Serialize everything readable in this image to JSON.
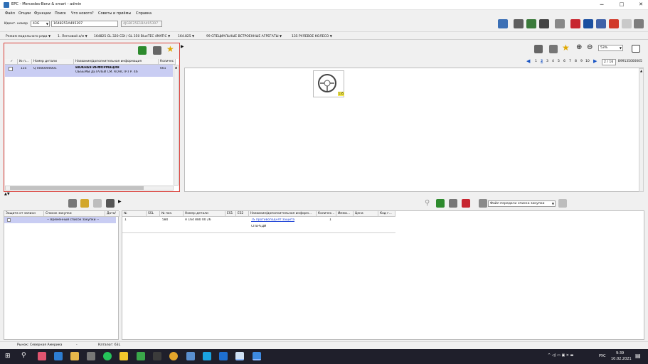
{
  "window": {
    "title": "EPC - Mercedes-Benz & smart - admin",
    "minimize": "─",
    "maximize": "□",
    "close": "✕"
  },
  "menu": [
    "Файл",
    "Опции",
    "Функции",
    "Поиск",
    "Что нового?",
    "Советы и приёмы",
    "Справка"
  ],
  "ident": {
    "label": "Идент. номер",
    "type_value": "43G",
    "number_value": "1648251A495397",
    "secondary_value": "4JGBF25E1BA495397"
  },
  "breadcrumbs": [
    "Режим модельного ряда",
    "1. Легковой а/м",
    "164825 GL 320 CDI / GL 350 BlueTEC 4MATIC",
    "164.825",
    "99 СПЕЦИАЛЬНЫЕ ВСТРОЕННЫЕ АГРЕГАТЫ",
    "135 РУЛЕВОЕ КОЛЕСО"
  ],
  "parts_table": {
    "columns": [
      "✓",
      "№ п...",
      "Номер детали",
      "Название/дополнительная информация",
      "Количес"
    ],
    "rows": [
      {
        "pos": "135",
        "part": "Q 0000000001",
        "title": "ВАЖНАЯ ИНФОРМАЦИЯ",
        "subtitle": "ОБЪЕМЫ ДЕТАЛЕЙ СМ. КОНСТР.ГР. 46",
        "qty": "001"
      }
    ]
  },
  "viewer": {
    "zoom": "53%",
    "pages": [
      "1",
      "2",
      "3",
      "4",
      "5",
      "6",
      "7",
      "8",
      "9",
      "10"
    ],
    "current_page": "2",
    "page_counter": "2 / 16",
    "sheet_id": "B99135000005",
    "callout": "135"
  },
  "shopping_lists": {
    "columns": [
      "Защита от записи",
      "Список закупки",
      "Дата/"
    ],
    "rows": [
      {
        "name": "-- Временный список закупки --"
      }
    ]
  },
  "order_table": {
    "transfer_label": "Файл передачи списка закупки",
    "columns": [
      "№",
      "SSL",
      "№ поз.",
      "Номер детали",
      "ES1",
      "ES2",
      "Название/дополнительная информ...",
      "Количес...",
      "Имею...",
      "Цена",
      "Код г..."
    ],
    "rows": [
      {
        "n": "1",
        "pos": "580",
        "part": "A 164 880 00 26",
        "name": "TS противоподнят.защита",
        "qty": "1",
        "note": "СПЕРЕДИ"
      }
    ]
  },
  "status": {
    "market": "Рынок: Северная Америка",
    "sep": "-",
    "catalog": "Каталог: 63L"
  },
  "taskbar": {
    "lang": "РУС",
    "time": "9:39",
    "date": "10.02.2021"
  }
}
